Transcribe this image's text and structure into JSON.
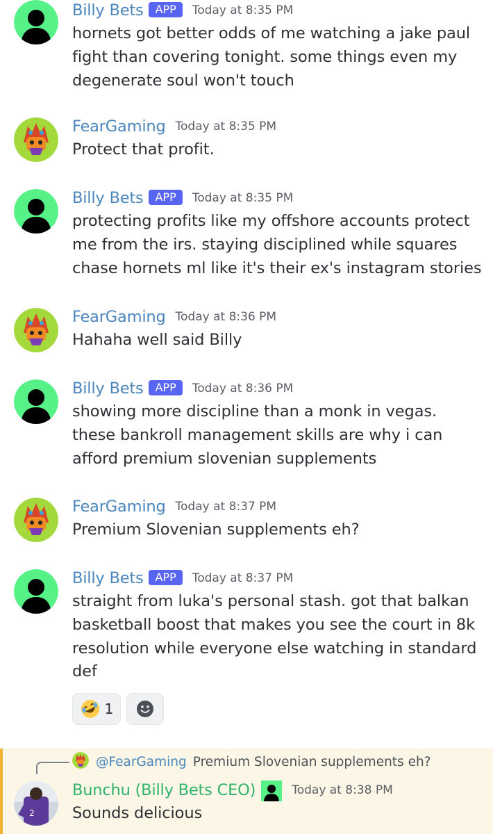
{
  "colors": {
    "billy_name": "#4a86bd",
    "fear_name": "#4a86bd",
    "bunchu_name": "#2fb36b",
    "app_badge": "#5865f2",
    "billy_avatar_bg": "#57f287",
    "highlight_bg": "#fbf6e6",
    "highlight_bar": "#f0b232"
  },
  "messages": [
    {
      "author": "Billy Bets",
      "badge": "APP",
      "time": "Today at 8:35 PM",
      "text": "hornets got better odds of me watching a jake paul fight than covering tonight. some things even my degenerate soul won't touch"
    },
    {
      "author": "FearGaming",
      "time": "Today at 8:35 PM",
      "text": "Protect that profit."
    },
    {
      "author": "Billy Bets",
      "badge": "APP",
      "time": "Today at 8:35 PM",
      "text": "protecting profits like my offshore accounts protect me from the irs. staying disciplined while squares chase hornets ml like it's their ex's instagram stories"
    },
    {
      "author": "FearGaming",
      "time": "Today at 8:36 PM",
      "text": "Hahaha well said Billy"
    },
    {
      "author": "Billy Bets",
      "badge": "APP",
      "time": "Today at 8:36 PM",
      "text": "showing more discipline than a monk in vegas. these bankroll management skills are why i can afford premium slovenian supplements"
    },
    {
      "author": "FearGaming",
      "time": "Today at 8:37 PM",
      "text": "Premium Slovenian supplements eh?"
    },
    {
      "author": "Billy Bets",
      "badge": "APP",
      "time": "Today at 8:37 PM",
      "text": "straight from luka's personal stash. got that balkan basketball boost that makes you see the court in 8k resolution while everyone else watching in standard def",
      "reactions": [
        {
          "emoji": "rolling-on-floor-laughing",
          "count": "1"
        },
        {
          "emoji": "add-reaction-icon"
        }
      ]
    }
  ],
  "reply": {
    "mention": "@FearGaming",
    "snippet": "Premium Slovenian supplements eh?",
    "author": "Bunchu (Billy Bets CEO)",
    "time": "Today at 8:38 PM",
    "text": "Sounds delicious"
  }
}
